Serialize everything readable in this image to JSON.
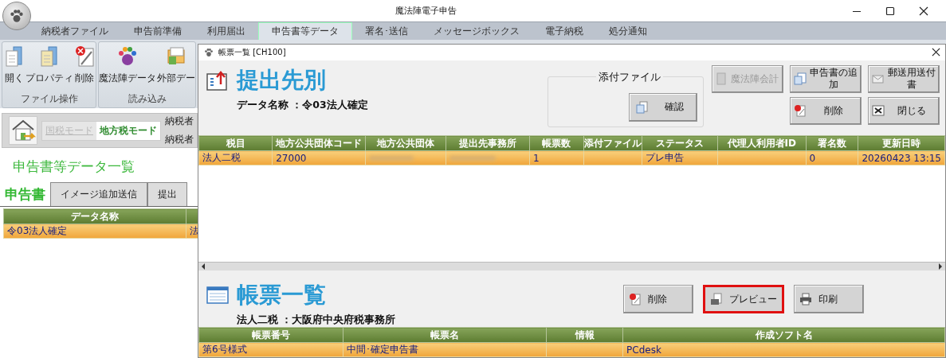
{
  "window": {
    "title": "魔法陣電子申告"
  },
  "tabs": [
    {
      "label": "納税者ファイル",
      "selected": false
    },
    {
      "label": "申告前準備",
      "selected": false
    },
    {
      "label": "利用届出",
      "selected": false
    },
    {
      "label": "申告書等データ",
      "selected": true
    },
    {
      "label": "署名･送信",
      "selected": false
    },
    {
      "label": "メッセージボックス",
      "selected": false
    },
    {
      "label": "電子納税",
      "selected": false
    },
    {
      "label": "処分通知",
      "selected": false
    }
  ],
  "ribbon_groups": [
    {
      "label": "ファイル操作",
      "items": [
        "開く",
        "プロパティ",
        "削除"
      ]
    },
    {
      "label": "読み込み",
      "items": [
        "魔法陣データ",
        "外部デー"
      ]
    }
  ],
  "mode_switch": [
    {
      "label": "国税モード",
      "selected": false
    },
    {
      "label": "地方税モード",
      "selected": true
    }
  ],
  "taxpayer_labels": [
    "納税者",
    "納税者"
  ],
  "list_title": "申告書等データ一覧",
  "sub_tabs": [
    {
      "label": "申告書",
      "selected": true
    },
    {
      "label": "イメージ追加送信",
      "selected": false
    },
    {
      "label": "提出",
      "selected": false
    }
  ],
  "data_table": {
    "columns": [
      "データ名称"
    ],
    "rows": [
      {
        "cells": [
          "令03法人確定",
          "法"
        ],
        "selected": true
      }
    ]
  },
  "dialog": {
    "title": "帳票一覧 [CH100]",
    "submission": {
      "heading": "提出先別",
      "subtitle": "データ名称 ：令03法人確定",
      "attachment": {
        "label": "添付ファイル",
        "button": "確認"
      },
      "buttons": [
        {
          "label": "魔法陣会計",
          "disabled": true
        },
        {
          "label": "申告書の追加",
          "disabled": false
        },
        {
          "label": "郵送用送付書",
          "disabled": false
        },
        {
          "label": "削除",
          "disabled": false
        },
        {
          "label": "閉じる",
          "disabled": false
        }
      ],
      "table": {
        "columns": [
          "税目",
          "地方公共団体コード",
          "地方公共団体",
          "提出先事務所",
          "帳票数",
          "添付ファイル",
          "ステータス",
          "代理人利用者ID",
          "署名数",
          "更新日時"
        ],
        "rows": [
          {
            "selected": true,
            "cells": [
              {
                "kind": "text",
                "text": "法人二税"
              },
              {
                "kind": "text",
                "text": "27000"
              },
              {
                "kind": "blurred"
              },
              {
                "kind": "blurred"
              },
              {
                "kind": "text",
                "text": "1"
              },
              {
                "kind": "empty"
              },
              {
                "kind": "text",
                "text": "プレ申告"
              },
              {
                "kind": "empty"
              },
              {
                "kind": "text",
                "text": "0"
              },
              {
                "kind": "text",
                "text": "20260423 13:15"
              }
            ]
          }
        ]
      }
    },
    "forms": {
      "heading": "帳票一覧",
      "subtitle": "法人二税 ：大阪府中央府税事務所",
      "buttons": [
        {
          "label": "削除",
          "highlighted": false
        },
        {
          "label": "プレビュー",
          "highlighted": true
        },
        {
          "label": "印刷",
          "highlighted": false
        }
      ],
      "table": {
        "columns": [
          "帳票番号",
          "帳票名",
          "情報",
          "作成ソフト名"
        ],
        "rows": [
          {
            "selected": true,
            "cells": [
              {
                "kind": "text",
                "text": "第6号様式"
              },
              {
                "kind": "text",
                "text": "中間･確定申告書"
              },
              {
                "kind": "empty"
              },
              {
                "kind": "text",
                "text": "PCdesk"
              }
            ]
          }
        ]
      }
    }
  }
}
